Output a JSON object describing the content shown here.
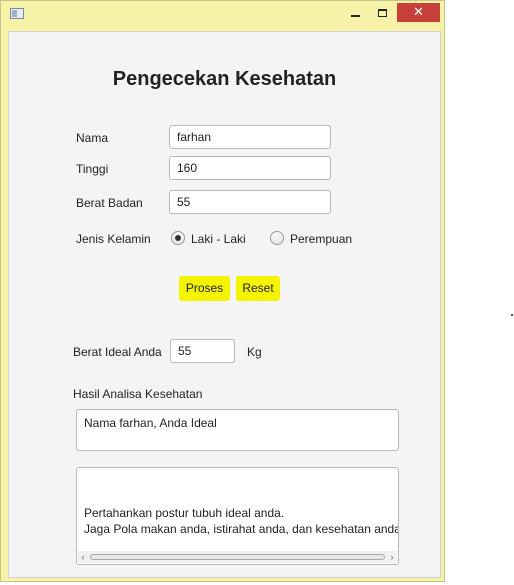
{
  "window": {
    "close_glyph": "✕",
    "icons": [
      "app-icon",
      "minimize-icon",
      "maximize-icon",
      "close-icon"
    ]
  },
  "form": {
    "title": "Pengecekan Kesehatan",
    "nama_label": "Nama",
    "nama_value": "farhan",
    "tinggi_label": "Tinggi",
    "tinggi_value": "160",
    "berat_label": "Berat Badan",
    "berat_value": "55",
    "jenis_kelamin_label": "Jenis Kelamin",
    "gender_options": [
      {
        "label": "Laki - Laki",
        "selected": true
      },
      {
        "label": "Perempuan",
        "selected": false
      }
    ],
    "proses_label": "Proses",
    "reset_label": "Reset",
    "button_color": "#f4f400"
  },
  "result": {
    "berat_ideal_label": "Berat Ideal Anda",
    "berat_ideal_value": "55",
    "unit": "Kg",
    "hasil_label": "Hasil Analisa Kesehatan",
    "hasil_text": "Nama farhan, Anda Ideal",
    "advice_text": "Pertahankan postur tubuh ideal anda.\nJaga Pola makan anda, istirahat anda, dan kesehatan anda."
  }
}
